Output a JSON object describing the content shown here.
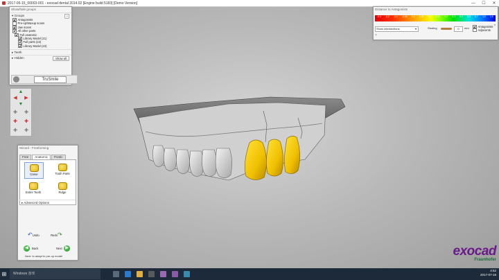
{
  "window": {
    "title": "2017-06-15_00003-001 - exocad dental 2014.02 [Engine build 5183] [Demo Version]",
    "minimize": "—",
    "maximize": "☐",
    "close": "✕"
  },
  "groups_panel": {
    "header": "Show/hide groups",
    "groups_label": "Groups",
    "help": "?",
    "items": [
      {
        "label": "Antagonists",
        "checked": true
      },
      {
        "label": "Pre-op/Waxup scans",
        "checked": false
      },
      {
        "label": "Jaw scans",
        "checked": true
      },
      {
        "label": "All other parts",
        "checked": true
      },
      {
        "label": "Full anatomic",
        "checked": true
      },
      {
        "label": "Library Model (21)",
        "checked": true
      },
      {
        "label": "Full parts (22)",
        "checked": true
      },
      {
        "label": "Library Model (23)",
        "checked": true
      }
    ],
    "teeth_label": "Teeth",
    "hidden_label": "Hidden",
    "show_all": "Show all",
    "trusmile": "TruSmile"
  },
  "wizard": {
    "header": "Wizard - Freeforming",
    "tabs": [
      "Free",
      "Anatomic",
      "Pontic"
    ],
    "active_tab": "Anatomic",
    "tools": [
      "Carve",
      "Tooth Parts",
      "Entire Tooth",
      "Ridge"
    ],
    "advanced": "Advanced Options",
    "undo": "Undo",
    "redo": "Redo",
    "back": "Back",
    "next": "Next",
    "footer": "Next: to adapt to pre-op model"
  },
  "distance_panel": {
    "header": "Distance to Antagonists",
    "ticks": [
      "-0.4",
      "-0.2",
      "-0.1",
      "-0.05",
      "0.0",
      "0.05",
      "0.1",
      "0.15",
      "0.2",
      "0.3",
      "0.4",
      "0.5",
      "0.7",
      "1.0",
      "1.5"
    ],
    "help": "?",
    "dropdown": "Show intersections",
    "studing_label": "Studing",
    "studing_value": "0",
    "unit": "mm",
    "check_antagonists": "Antagonists",
    "check_adjacents": "Adjacents",
    "gradient_colors": [
      "#e00000",
      "#ff8000",
      "#ffd000",
      "#80ff00",
      "#00e000",
      "#00e0e0",
      "#0080ff",
      "#0000e0"
    ]
  },
  "brand": {
    "name": "exocad",
    "partner": "Fraunhofer"
  },
  "taskbar": {
    "search": "Windows 검색",
    "time": "4:52",
    "date": "2017-07-18"
  }
}
